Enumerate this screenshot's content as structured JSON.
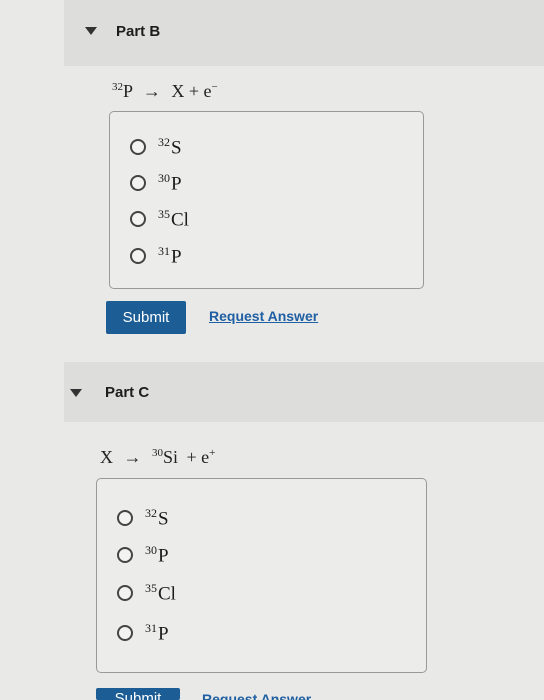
{
  "part_b": {
    "title": "Part B",
    "equation": {
      "left_mass": "32",
      "left_symbol": "P",
      "arrow": "→",
      "right_text": "X + e",
      "right_sup": "−"
    },
    "choices": [
      {
        "mass": "32",
        "symbol": "S"
      },
      {
        "mass": "30",
        "symbol": "P"
      },
      {
        "mass": "35",
        "symbol": "Cl"
      },
      {
        "mass": "31",
        "symbol": "P"
      }
    ],
    "submit_label": "Submit",
    "request_label": "Request Answer"
  },
  "part_c": {
    "title": "Part C",
    "equation": {
      "left_text": "X",
      "arrow": "→",
      "right_mass": "30",
      "right_symbol": "Si",
      "plus": "+ e",
      "right_sup": "+"
    },
    "choices": [
      {
        "mass": "32",
        "symbol": "S"
      },
      {
        "mass": "30",
        "symbol": "P"
      },
      {
        "mass": "35",
        "symbol": "Cl"
      },
      {
        "mass": "31",
        "symbol": "P"
      }
    ],
    "submit_label": "Submit",
    "request_label": "Request Answer"
  }
}
